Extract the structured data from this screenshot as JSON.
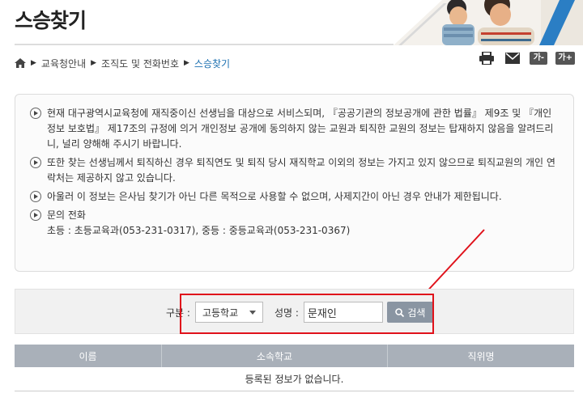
{
  "page": {
    "title": "스승찾기"
  },
  "breadcrumb": {
    "home_icon": "home-icon",
    "items": [
      "교육청안내",
      "조직도 및 전화번호"
    ],
    "current": "스승찾기"
  },
  "tools": {
    "print_icon": "print-icon",
    "mail_icon": "mail-icon",
    "font_decrease": "가-",
    "font_increase": "가+"
  },
  "notice": {
    "items": [
      "현재 대구광역시교육청에 재직중이신 선생님을 대상으로 서비스되며, 『공공기관의 정보공개에 관한 법률』 제9조 및 『개인정보 보호법』 제17조의 규정에 의거 개인정보 공개에 동의하지 않는 교원과 퇴직한 교원의 정보는 탑재하지 않음을 알려드리니, 널리 양해해 주시기 바랍니다.",
      "또한 찾는 선생님께서 퇴직하신 경우 퇴직연도 및 퇴직 당시 재직학교 이외의 정보는 가지고 있지 않으므로 퇴직교원의 개인 연락처는 제공하지 않고 있습니다.",
      "아울러 이 정보는 은사님 찾기가 아닌 다른 목적으로 사용할 수 없으며, 사제지간이 아닌 경우 안내가 제한됩니다."
    ],
    "contact_title": "문의 전화",
    "contact_detail": "초등 : 초등교육과(053-231-0317), 중등 : 중등교육과(053-231-0367)"
  },
  "search": {
    "category_label": "구분 :",
    "category_value": "고등학교",
    "name_label": "성명 :",
    "name_value": "문재인",
    "button_label": "검색",
    "highlight_color": "#e0121b"
  },
  "table": {
    "headers": [
      "이름",
      "소속학교",
      "직위명"
    ],
    "empty_message": "등록된 정보가 없습니다."
  }
}
